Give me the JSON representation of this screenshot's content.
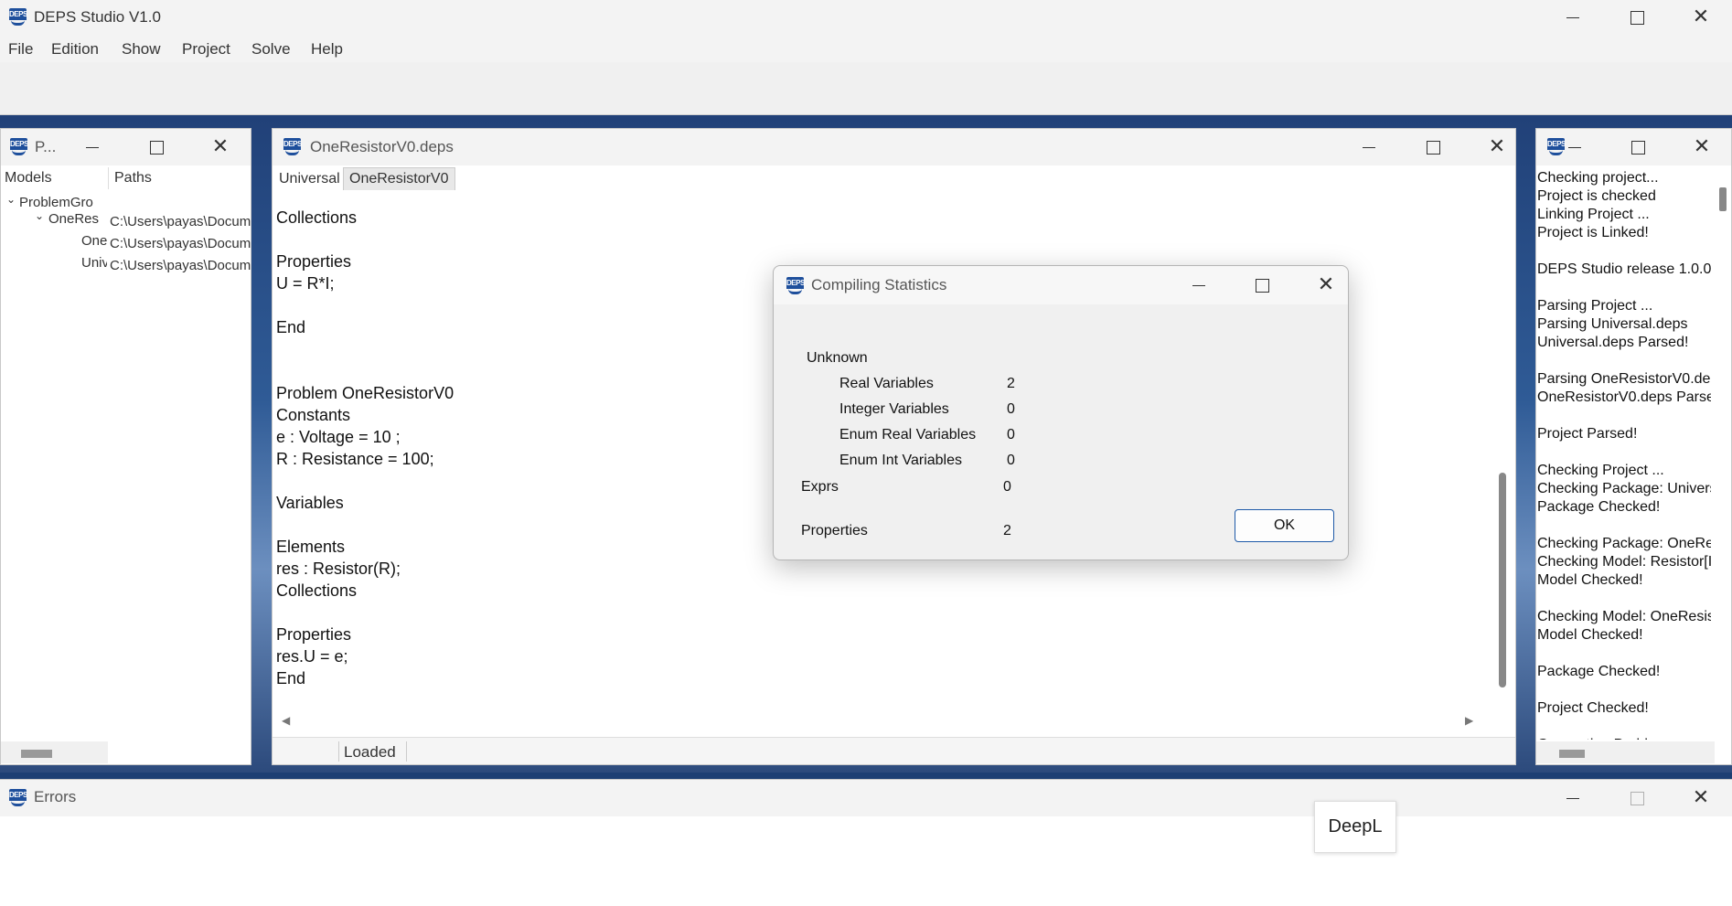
{
  "app": {
    "title": "DEPS Studio V1.0"
  },
  "menu": [
    "File",
    "Edition",
    "Show",
    "Project",
    "Solve",
    "Help"
  ],
  "project_panel": {
    "title": "P...",
    "columns": [
      "Models",
      "Paths"
    ],
    "tree": [
      {
        "name": "ProblemGro",
        "path": ""
      },
      {
        "name": "OneRes",
        "path": "C:\\Users\\payas\\Docum"
      },
      {
        "name": "One",
        "path": "C:\\Users\\payas\\Docum"
      },
      {
        "name": "Univ",
        "path": "C:\\Users\\payas\\Docum"
      }
    ]
  },
  "editor": {
    "title": "OneResistorV0.deps",
    "tabs": [
      "Universal",
      "OneResistorV0"
    ],
    "lines": [
      "Collections",
      "",
      "Properties",
      "U = R*I;",
      "",
      "End",
      "",
      "",
      "Problem OneResistorV0",
      "Constants",
      "e : Voltage = 10 ;",
      "R : Resistance = 100;",
      "",
      "Variables",
      "",
      "Elements",
      "res : Resistor(R);",
      "Collections",
      "",
      "Properties",
      "res.U = e;",
      "End"
    ],
    "status": "Loaded"
  },
  "dialog": {
    "title": "Compiling Statistics",
    "unknown_label": "Unknown",
    "rows": [
      {
        "label": "Real Variables",
        "value": "2"
      },
      {
        "label": "Integer Variables",
        "value": "0"
      },
      {
        "label": "Enum Real Variables",
        "value": "0"
      },
      {
        "label": "Enum Int Variables",
        "value": "0"
      }
    ],
    "exprs_label": "Exprs",
    "exprs_value": "0",
    "properties_label": "Properties",
    "properties_value": "2",
    "ok_label": "OK"
  },
  "log_panel": {
    "lines": [
      "Checking project...",
      "Project is checked",
      "Linking Project ...",
      "Project is Linked!",
      "",
      "DEPS Studio release 1.0.0",
      "",
      "Parsing Project ...",
      "Parsing Universal.deps",
      "Universal.deps Parsed!",
      "",
      "Parsing OneResistorV0.de",
      "OneResistorV0.deps Parse",
      "",
      "Project Parsed!",
      "",
      "Checking Project ...",
      "Checking Package: Univers",
      "Package Checked!",
      "",
      "Checking Package: OneRe",
      "Checking Model: Resistor[I",
      "Model Checked!",
      "",
      "Checking Model: OneResis",
      "Model Checked!",
      "",
      "Package Checked!",
      "",
      "Project Checked!",
      "",
      "Generating Problem"
    ]
  },
  "errors_panel": {
    "title": "Errors"
  },
  "tooltip": {
    "text": "DeepL"
  },
  "colors": {
    "accent": "#1e4f9c",
    "window_bg": "#f3f3f3",
    "desktop": "#1d3f73"
  }
}
